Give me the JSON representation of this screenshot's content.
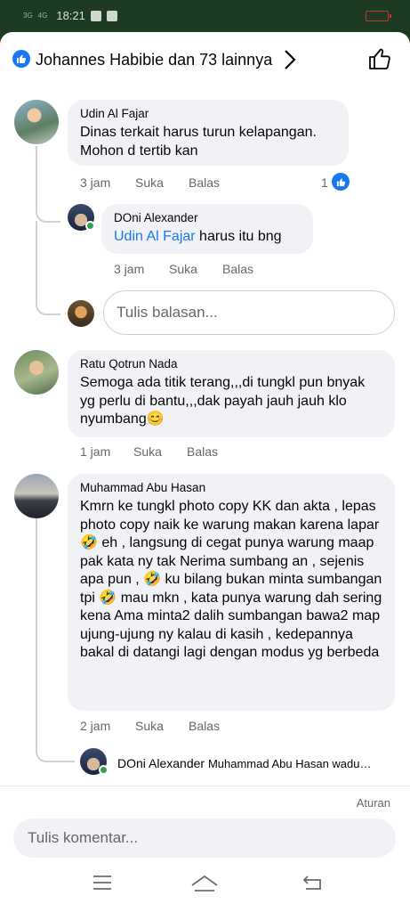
{
  "status_bar": {
    "signal1": "3G",
    "signal2": "4G",
    "time": "18:21"
  },
  "header": {
    "reactions_text": "Johannes Habibie dan 73 lainnya",
    "like_icon": "like-thumb-icon",
    "chevron_icon": "chevron-right-icon",
    "action_icon": "thumbs-up-outline-icon"
  },
  "comments": [
    {
      "author": "Udin Al Fajar",
      "text": "Dinas terkait harus turun kelapangan. Mohon d tertib kan",
      "time": "3 jam",
      "like": "Suka",
      "reply": "Balas",
      "reaction_count": "1"
    },
    {
      "author": "DOni Alexander",
      "tag": "Udin Al Fajar",
      "text": " harus itu bng",
      "time": "3 jam",
      "like": "Suka",
      "reply": "Balas"
    },
    {
      "author": "Ratu Qotrun Nada",
      "text": "Semoga ada titik terang,,,di tungkl pun bnyak yg perlu di bantu,,,dak payah jauh jauh klo nyumbang😊",
      "time": "1 jam",
      "like": "Suka",
      "reply": "Balas"
    },
    {
      "author": "Muhammad Abu Hasan",
      "text": "Kmrn ke tungkl photo copy KK dan akta , lepas photo copy naik ke warung makan karena lapar 🤣 eh , langsung di cegat punya warung maap pak kata ny tak Nerima sumbang an , sejenis apa pun , 🤣 ku bilang bukan minta sumbangan tpi 🤣 mau mkn , kata punya warung dah sering kena Ama minta2 dalih sumbangan bawa2 map ujung-ujung ny kalau di kasih , kedepannya bakal di datangi lagi dengan modus yg berbeda",
      "time": "2 jam",
      "like": "Suka",
      "reply": "Balas"
    }
  ],
  "reply_preview": {
    "author": "DOni Alexander",
    "text": "Muhammad Abu Hasan wadu…"
  },
  "reply_input": {
    "placeholder": "Tulis balasan..."
  },
  "footer": {
    "rules_label": "Aturan",
    "comment_placeholder": "Tulis komentar..."
  },
  "nav": {
    "menu_icon": "menu-lines-icon",
    "home_icon": "home-icon",
    "back_icon": "back-icon"
  },
  "colors": {
    "accent": "#1877f2",
    "bubble": "#f0f2f5",
    "muted": "#65676b",
    "status_bar": "#1d3b22"
  }
}
